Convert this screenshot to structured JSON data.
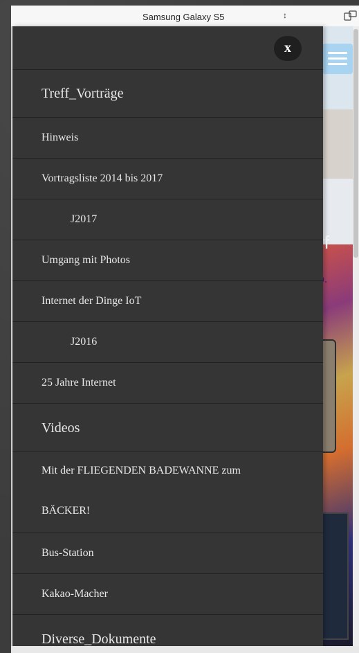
{
  "device_toolbar": {
    "device_name": "Samsung Galaxy S5",
    "select_arrow": "↕"
  },
  "website_bg": {
    "art_text1": "rf",
    "art_text2": "p."
  },
  "menu": {
    "close_label": "x",
    "items": [
      {
        "label": "Treff_Vorträge",
        "type": "heading",
        "indent": false
      },
      {
        "label": "Hinweis",
        "type": "normal",
        "indent": false
      },
      {
        "label": "Vortragsliste 2014 bis 2017",
        "type": "normal",
        "indent": false
      },
      {
        "label": "J2017",
        "type": "normal",
        "indent": true
      },
      {
        "label": "Umgang mit Photos",
        "type": "normal",
        "indent": false
      },
      {
        "label": "Internet der Dinge IoT",
        "type": "normal",
        "indent": false
      },
      {
        "label": "J2016",
        "type": "normal",
        "indent": true
      },
      {
        "label": "25 Jahre Internet",
        "type": "normal",
        "indent": false
      },
      {
        "label": "Videos",
        "type": "heading",
        "indent": false
      },
      {
        "label": "Mit der FLIEGENDEN BADEWANNE zum",
        "label2": "BÄCKER!",
        "type": "normal",
        "indent": false
      },
      {
        "label": "Bus-Station",
        "type": "normal",
        "indent": false
      },
      {
        "label": "Kakao-Macher",
        "type": "normal",
        "indent": false
      },
      {
        "label": "Diverse_Dokumente",
        "type": "heading",
        "indent": false
      }
    ]
  }
}
